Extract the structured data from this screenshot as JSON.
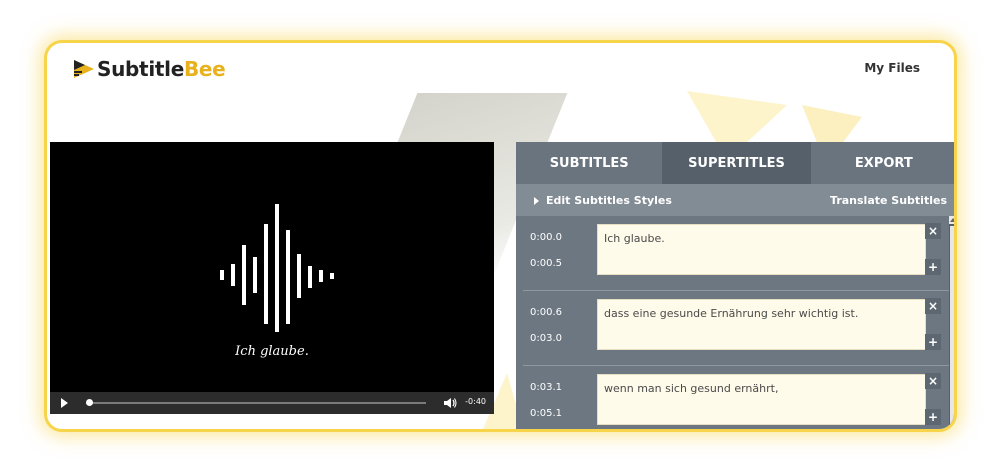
{
  "header": {
    "logo_part1": "Subtitle",
    "logo_part2": "Bee",
    "my_files": "My Files"
  },
  "player": {
    "caption": "Ich glaube.",
    "time_remaining": "-0:40",
    "progress": 0.01
  },
  "panel": {
    "tabs": [
      {
        "label": "SUBTITLES",
        "active": false
      },
      {
        "label": "SUPERTITLES",
        "active": true
      },
      {
        "label": "EXPORT",
        "active": false
      }
    ],
    "edit_styles": "Edit Subtitles Styles",
    "translate": "Translate Subtitles",
    "rows": [
      {
        "start": "0:00.0",
        "end": "0:00.5",
        "text": "Ich glaube."
      },
      {
        "start": "0:00.6",
        "end": "0:03.0",
        "text": "dass eine gesunde Ernährung sehr wichtig ist."
      },
      {
        "start": "0:03.1",
        "end": "0:05.1",
        "text": "wenn man sich gesund ernährt,"
      }
    ],
    "delete_glyph": "×",
    "add_glyph": "+"
  },
  "colors": {
    "accent_yellow": "#f7d44a",
    "logo_yellow": "#e7b21b",
    "panel_gray": "#6d7781",
    "textbox_bg": "#fffbea"
  },
  "icons": [
    "logo-mark-icon",
    "play-icon",
    "volume-icon",
    "caret-right-icon",
    "close-icon",
    "plus-icon",
    "scroll-up-icon"
  ]
}
